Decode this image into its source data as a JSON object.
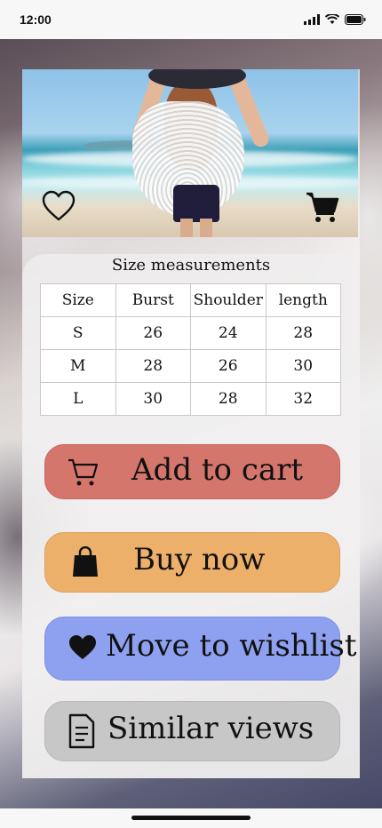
{
  "status_bar": {
    "time": "12:00"
  },
  "size_chart": {
    "title": "Size measurements",
    "columns": [
      "Size",
      "Burst",
      "Shoulder",
      "length"
    ],
    "rows": [
      [
        "S",
        "26",
        "24",
        "28"
      ],
      [
        "M",
        "28",
        "26",
        "30"
      ],
      [
        "L",
        "30",
        "28",
        "32"
      ]
    ]
  },
  "actions": {
    "add_to_cart": {
      "label": "Add to cart",
      "color": "#d5766c"
    },
    "buy_now": {
      "label": "Buy now",
      "color": "#edb06b"
    },
    "move_to_wishlist": {
      "label": "Move to wishlist",
      "color": "#8ea0f0"
    },
    "similar_views": {
      "label": "Similar views",
      "color": "#c7c7c7"
    }
  },
  "icons": {
    "wishlist_toggle": "heart-outline-icon",
    "cart": "shopping-cart-icon",
    "buy": "shopping-bag-icon",
    "wishlist": "heart-filled-icon",
    "similar": "document-icon"
  }
}
